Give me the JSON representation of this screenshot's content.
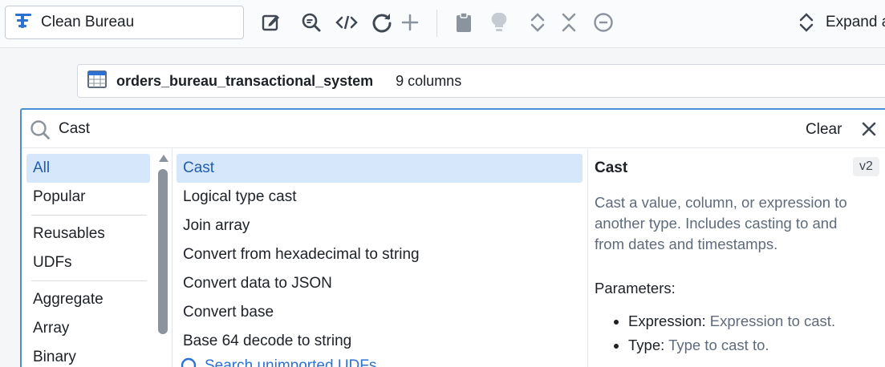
{
  "toolbar": {
    "board_name": "Clean Bureau",
    "expand_label": "Expand a",
    "icons": [
      "edit-icon",
      "search-preview-icon",
      "code-icon",
      "refresh-icon",
      "add-icon",
      "clipboard-icon",
      "lightbulb-icon",
      "expand-collapse-icon",
      "collapse-icon",
      "remove-icon",
      "expand-all-icon"
    ]
  },
  "dataset": {
    "name": "orders_bureau_transactional_system",
    "columns": "9 columns"
  },
  "search": {
    "query": "Cast",
    "clear_label": "Clear"
  },
  "categories": {
    "group1": [
      "All",
      "Popular"
    ],
    "group2": [
      "Reusables",
      "UDFs"
    ],
    "group3": [
      "Aggregate",
      "Array",
      "Binary"
    ],
    "active": "All"
  },
  "functions": {
    "items": [
      "Cast",
      "Logical type cast",
      "Join array",
      "Convert from hexadecimal to string",
      "Convert data to JSON",
      "Convert base",
      "Base 64 decode to string"
    ],
    "active": "Cast",
    "search_more": "Search unimported UDFs"
  },
  "detail": {
    "title": "Cast",
    "version": "v2",
    "description": "Cast a value, column, or expression to another type. Includes casting to and from dates and timestamps.",
    "parameters_label": "Parameters:",
    "parameters": [
      {
        "name": "Expression:",
        "desc": "Expression to cast."
      },
      {
        "name": "Type:",
        "desc": "Type to cast to."
      }
    ]
  },
  "colors": {
    "accent": "#2d72d2",
    "active_bg": "#d6e6fb",
    "panel_border": "#4d8fd6"
  }
}
